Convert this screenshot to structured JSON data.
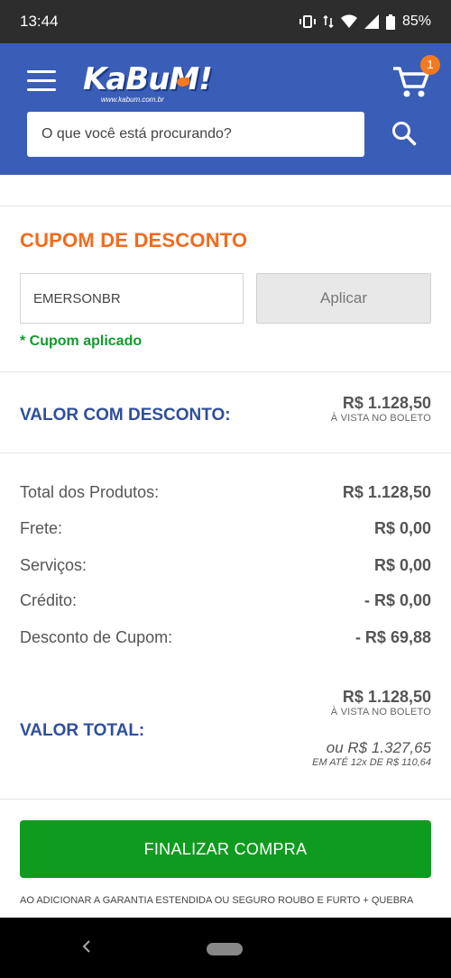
{
  "status_bar": {
    "time": "13:44",
    "battery": "85%"
  },
  "header": {
    "logo_text": "KaBuM!",
    "logo_sub": "www.kabum.com.br",
    "cart_count": "1",
    "search_placeholder": "O que você está procurando?"
  },
  "coupon": {
    "title": "CUPOM DE DESCONTO",
    "code_value": "EMERSONBR",
    "apply_label": "Aplicar",
    "applied_msg": "* Cupom aplicado"
  },
  "discount_value": {
    "label": "VALOR COM DESCONTO:",
    "amount": "R$ 1.128,50",
    "note": "À VISTA NO BOLETO"
  },
  "summary": [
    {
      "label": "Total dos Produtos:",
      "value": "R$ 1.128,50"
    },
    {
      "label": "Frete:",
      "value": "R$ 0,00"
    },
    {
      "label": "Serviços:",
      "value": "R$ 0,00"
    },
    {
      "label": "Crédito:",
      "value": "- R$ 0,00"
    },
    {
      "label": "Desconto de Cupom:",
      "value": "- R$ 69,88"
    }
  ],
  "total": {
    "label": "VALOR TOTAL:",
    "amount": "R$ 1.128,50",
    "note": "À VISTA NO BOLETO",
    "installment_total": "ou R$ 1.327,65",
    "installment_note": "EM ATÉ 12x DE R$ 110,64"
  },
  "finalize_label": "FINALIZAR COMPRA",
  "disclaimer": "AO ADICIONAR A GARANTIA ESTENDIDA OU SEGURO ROUBO E FURTO + QUEBRA",
  "colors": {
    "header": "#3a5eb7",
    "accent_orange": "#f26b1d",
    "green": "#0f9b1f",
    "blue_text": "#2f4f9b"
  }
}
